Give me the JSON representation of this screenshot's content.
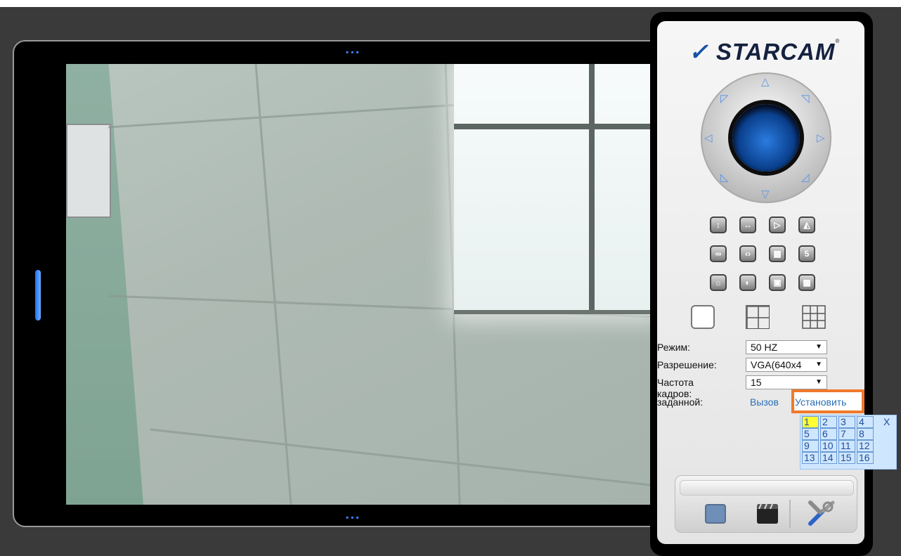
{
  "app": {
    "logo": "STARCAM",
    "reg_mark": "®"
  },
  "panel": {
    "form": {
      "mode_label": "Режим:",
      "mode_value": "50 HZ",
      "resolution_label": "Разрешение:",
      "resolution_value": "VGA(640x4",
      "fps_label": "Частота кадров:",
      "fps_value": "15",
      "preset_label": "заданной:",
      "call_link": "Вызов",
      "set_button": "Установить"
    },
    "preset_grid": {
      "cells": [
        "1",
        "2",
        "3",
        "4",
        "5",
        "6",
        "7",
        "8",
        "9",
        "10",
        "11",
        "12",
        "13",
        "14",
        "15",
        "16"
      ],
      "close": "X",
      "selected": "1"
    },
    "tools": {
      "row1": [
        "flip-vertical-icon",
        "flip-horizontal-icon",
        "flip-right-icon",
        "mirror-icon"
      ],
      "row2": [
        "infinity-icon",
        "code-icon",
        "grid-icon",
        "5"
      ],
      "row3": [
        "brightness-icon",
        "contrast-icon",
        "display-icon",
        "color-icon"
      ]
    },
    "layouts": [
      "single-view-icon",
      "four-view-icon",
      "nine-view-icon"
    ],
    "bottom_icons": [
      "camera-icon",
      "clapper-icon",
      "settings-tools-icon"
    ]
  },
  "colors": {
    "accent": "#2b6fb7",
    "highlight": "#f0792a",
    "preset_active": "#ffff33"
  }
}
